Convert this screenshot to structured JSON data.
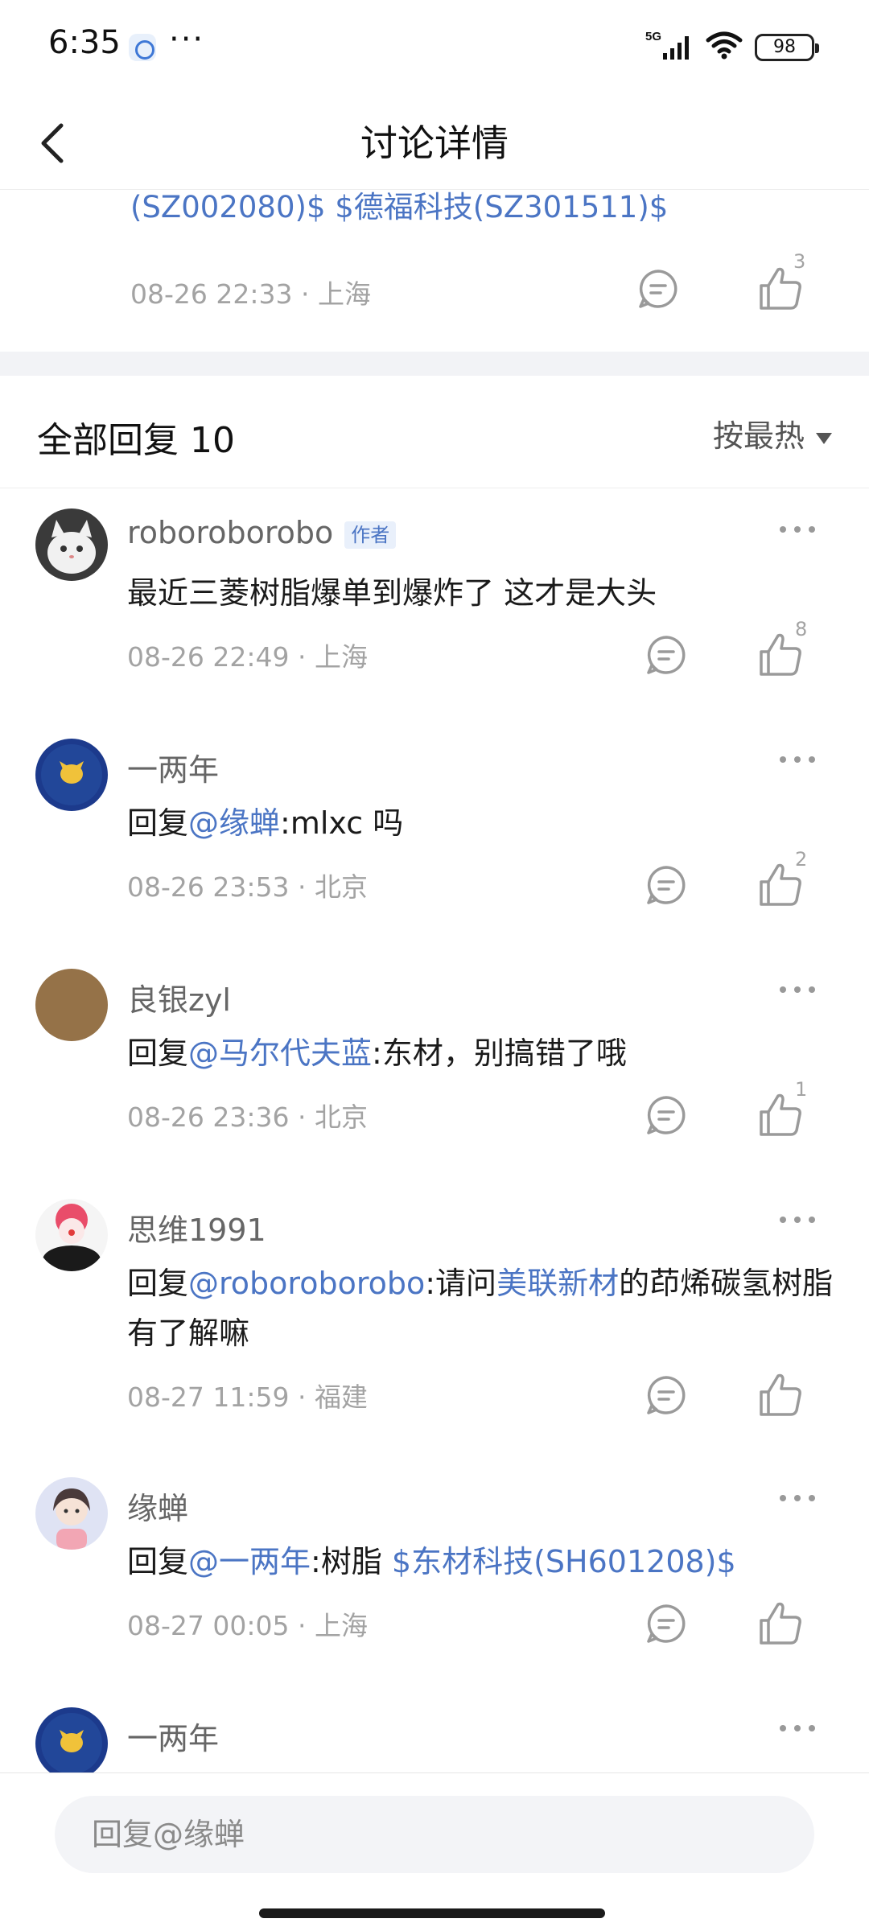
{
  "status_bar": {
    "time": "6:35",
    "dots": "···",
    "network": "5G",
    "battery": "98"
  },
  "header": {
    "title": "讨论详情"
  },
  "post": {
    "links_prefix": "(SZ002080)$",
    "link_2": "$德福科技(SZ301511)$",
    "date": "08-26 22:33",
    "location": "上海",
    "like_count": "3"
  },
  "replies_header": {
    "title": "全部回复 10",
    "sort_label": "按最热"
  },
  "replies": [
    {
      "author": "roboroborobo",
      "badge": "作者",
      "text": "最近三菱树脂爆单到爆炸了 这才是大头",
      "date": "08-26 22:49",
      "location": "上海",
      "like_count": "8"
    },
    {
      "author": "一两年",
      "prefix": "回复",
      "mention": "@缘蝉",
      "text": ":mlxc 吗",
      "date": "08-26 23:53",
      "location": "北京",
      "like_count": "2"
    },
    {
      "author": "良银zyl",
      "prefix": "回复",
      "mention": "@马尔代夫蓝",
      "text": ":东材，别搞错了哦",
      "date": "08-26 23:36",
      "location": "北京",
      "like_count": "1"
    },
    {
      "author": "思维1991",
      "prefix": "回复",
      "mention": "@roboroborobo",
      "text_1": ":请问",
      "link": "美联新材",
      "text_2": "的茚烯碳氢树脂有了解嘛",
      "date": "08-27 11:59",
      "location": "福建",
      "like_count": ""
    },
    {
      "author": "缘蝉",
      "prefix": "回复",
      "mention": "@一两年",
      "text": ":树脂 ",
      "stock": "$东材科技(SH601208)$",
      "date": "08-27 00:05",
      "location": "上海",
      "like_count": ""
    },
    {
      "author": "一两年"
    }
  ],
  "input": {
    "placeholder": "回复@缘蝉"
  },
  "colors": {
    "link": "#4b75c4",
    "meta": "#a3a3a3",
    "band": "#f2f3f6"
  }
}
